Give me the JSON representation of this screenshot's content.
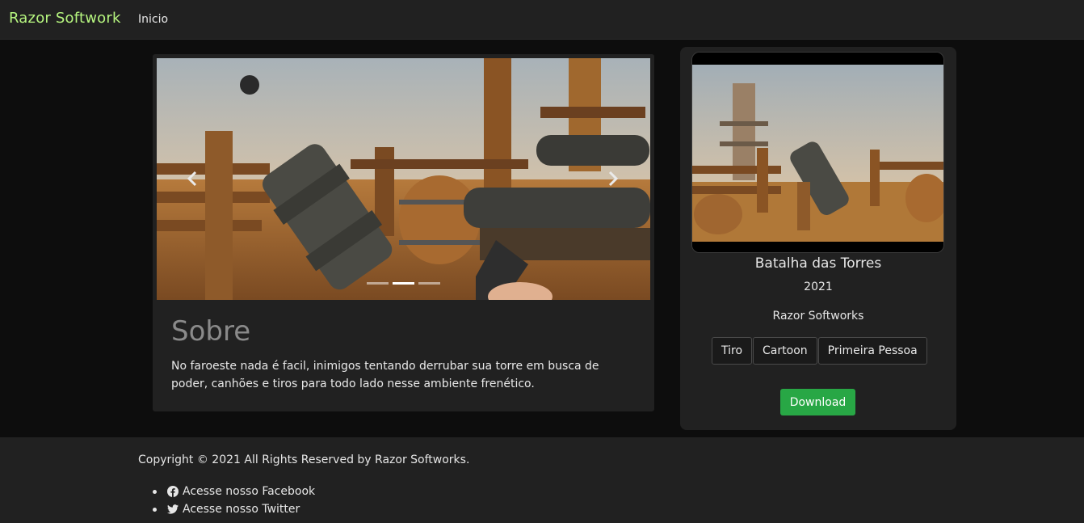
{
  "navbar": {
    "brand": "Razor Softwork",
    "links": [
      {
        "label": "Inicio"
      }
    ]
  },
  "main": {
    "carousel": {
      "slide_count": 3,
      "active_index": 1,
      "prev_icon": "chevron-left-icon",
      "next_icon": "chevron-right-icon"
    },
    "about": {
      "title": "Sobre",
      "text": "No faroeste nada é facil, inimigos tentando derrubar sua torre em busca de poder, canhões e tiros para todo lado nesse ambiente frenético."
    }
  },
  "game": {
    "title": "Batalha das Torres",
    "year": "2021",
    "developer": "Razor Softworks",
    "tags": [
      "Tiro",
      "Cartoon",
      "Primeira Pessoa"
    ],
    "download_label": "Download"
  },
  "footer": {
    "copyright": "Copyright © 2021 All Rights Reserved by Razor Softworks.",
    "links": [
      {
        "icon": "facebook-icon",
        "label": "Acesse nosso Facebook"
      },
      {
        "icon": "twitter-icon",
        "label": "Acesse nosso Twitter"
      }
    ]
  },
  "colors": {
    "brand": "#b6f57f",
    "download": "#28a745",
    "background": "#0d0d0d",
    "panel": "#212121"
  }
}
